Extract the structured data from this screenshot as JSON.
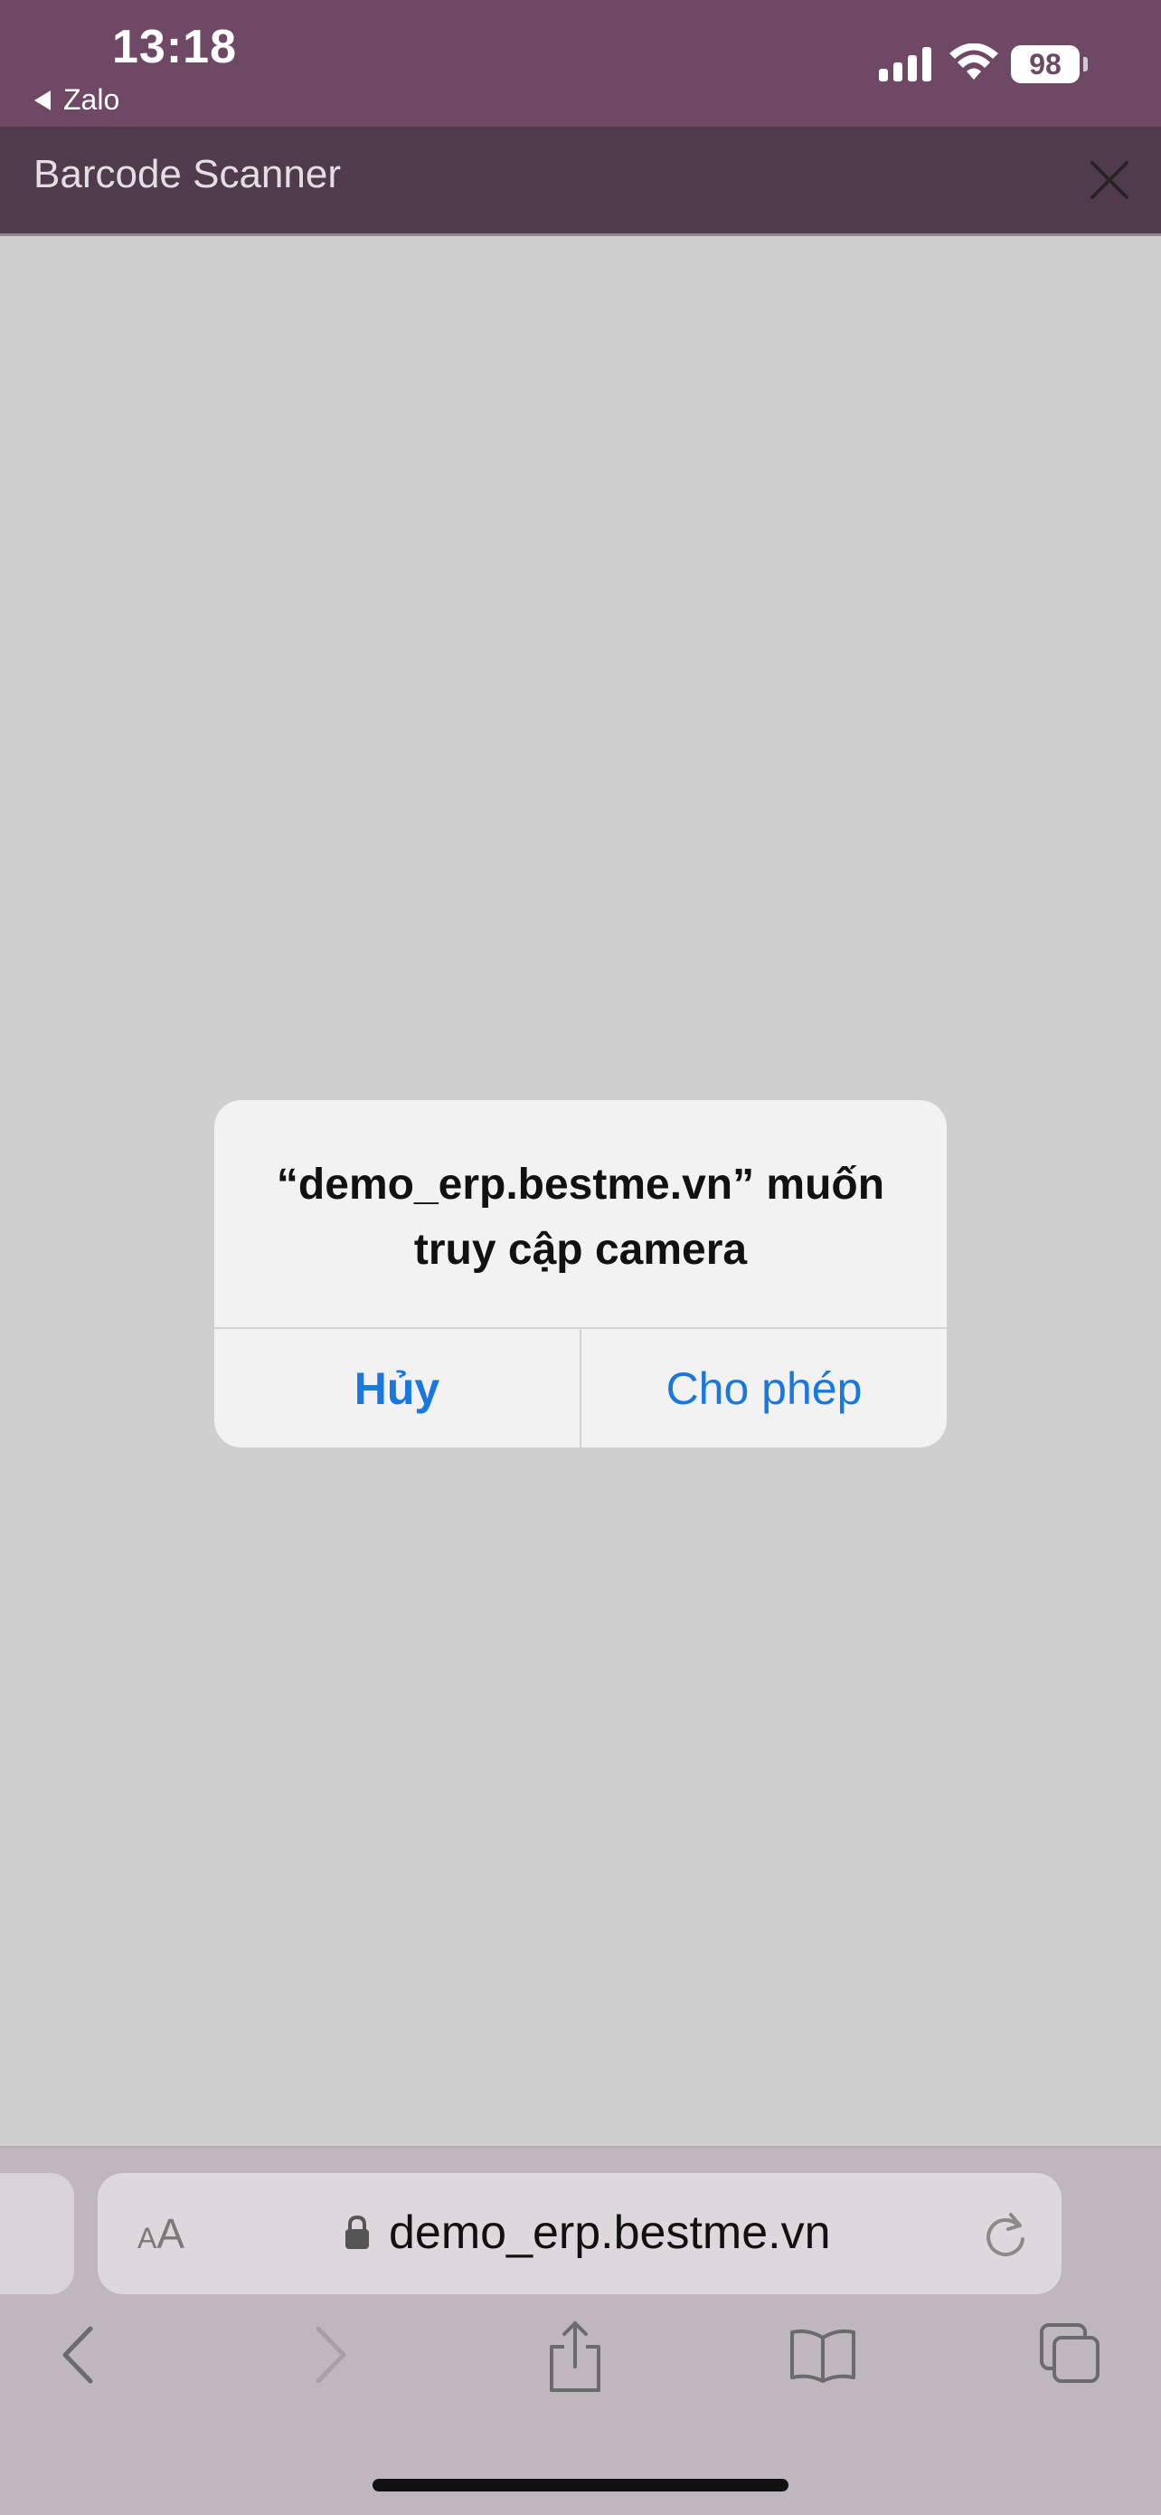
{
  "status_bar": {
    "time": "13:18",
    "back_app": "Zalo",
    "battery": "98"
  },
  "header": {
    "title": "Barcode Scanner"
  },
  "dialog": {
    "title_line1": "“demo_erp.bestme.vn” muốn",
    "title_line2": "truy cập camera",
    "cancel_label": "Hủy",
    "allow_label": "Cho phép"
  },
  "browser": {
    "aa_label_small": "A",
    "aa_label_large": "A",
    "url": "demo_erp.bestme.vn"
  },
  "colors": {
    "status_bar_bg": "#6f4865",
    "header_bg": "#4f3b4b",
    "page_bg": "#cfcfcf",
    "dialog_button": "#1877e0"
  },
  "icons": [
    "back-triangle-icon",
    "signal-icon",
    "wifi-icon",
    "battery-icon",
    "close-icon",
    "lock-icon",
    "reload-icon",
    "back-icon",
    "forward-icon",
    "share-icon",
    "bookmarks-icon",
    "tabs-icon"
  ]
}
